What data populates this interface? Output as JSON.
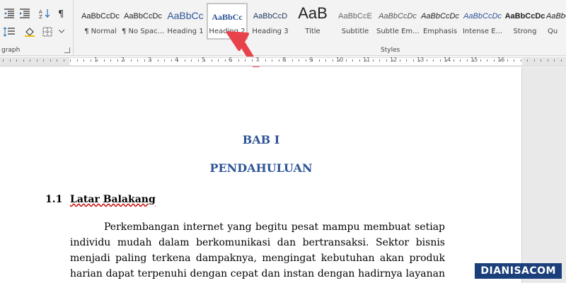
{
  "ribbon": {
    "paragraph_group_label": "graph",
    "styles_group_label": "Styles",
    "styles": [
      {
        "sample": "AaBbCcDc",
        "name": "¶ Normal"
      },
      {
        "sample": "AaBbCcDc",
        "name": "¶ No Spac..."
      },
      {
        "sample": "AaBbCc",
        "name": "Heading 1"
      },
      {
        "sample": "AaBbCc",
        "name": "Heading 2"
      },
      {
        "sample": "AaBbCcD",
        "name": "Heading 3"
      },
      {
        "sample": "AaB",
        "name": "Title"
      },
      {
        "sample": "AaBbCcE",
        "name": "Subtitle"
      },
      {
        "sample": "AaBbCcDc",
        "name": "Subtle Em..."
      },
      {
        "sample": "AaBbCcDc",
        "name": "Emphasis"
      },
      {
        "sample": "AaBbCcDc",
        "name": "Intense E..."
      },
      {
        "sample": "AaBbCcDc",
        "name": "Strong"
      },
      {
        "sample": "AaBbCcDc",
        "name": "Qu"
      }
    ],
    "active_style": "Heading 2"
  },
  "ruler": {
    "numbers": [
      "1",
      "2",
      "3",
      "4",
      "5",
      "6",
      "7",
      "8",
      "9",
      "10",
      "11",
      "12",
      "13",
      "14",
      "15",
      "16"
    ]
  },
  "document": {
    "title_line1": "BAB I",
    "title_line2": "PENDAHULUAN",
    "heading_number": "1.1",
    "heading_text": "Latar Balakang",
    "paragraph": "Perkembangan internet yang begitu pesat mampu membuat setiap individu mudah dalam berkomunikasi dan bertransaksi. Sektor bisnis menjadi paling terkena dampaknya, mengingat kebutuhan akan produk harian dapat terpenuhi dengan cepat dan instan dengan hadirnya layanan akses internet."
  },
  "watermark": "DIANISACOM",
  "colors": {
    "heading_blue": "#2e5496",
    "arrow_red": "#e8424b",
    "watermark_bg": "#1a3f7a"
  }
}
